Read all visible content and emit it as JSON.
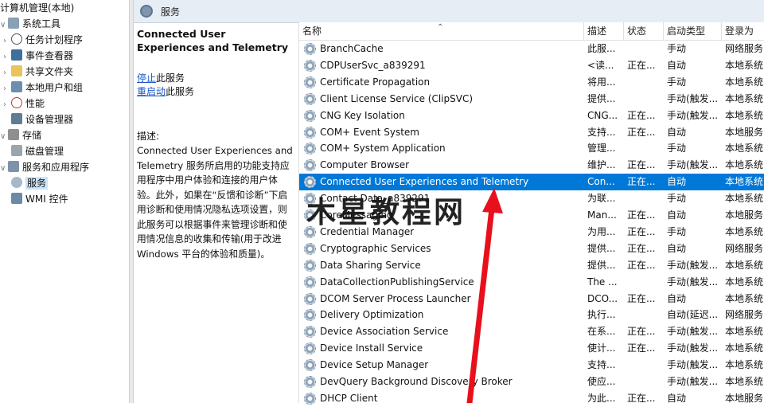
{
  "tree": {
    "root": "计算机管理(本地)",
    "items": [
      {
        "label": "系统工具",
        "icon": "tools-icon"
      },
      {
        "label": "任务计划程序",
        "icon": "clock-icon"
      },
      {
        "label": "事件查看器",
        "icon": "event-viewer-icon"
      },
      {
        "label": "共享文件夹",
        "icon": "shared-folder-icon"
      },
      {
        "label": "本地用户和组",
        "icon": "users-icon"
      },
      {
        "label": "性能",
        "icon": "performance-icon"
      },
      {
        "label": "设备管理器",
        "icon": "device-manager-icon"
      },
      {
        "label": "存储",
        "icon": "storage-icon"
      },
      {
        "label": "磁盘管理",
        "icon": "disk-icon"
      },
      {
        "label": "服务和应用程序",
        "icon": "services-apps-icon"
      },
      {
        "label": "服务",
        "icon": "services-icon"
      },
      {
        "label": "WMI 控件",
        "icon": "wmi-icon"
      }
    ]
  },
  "header": {
    "title": "服务"
  },
  "description": {
    "service_title": "Connected User Experiences and Telemetry",
    "stop_link": "停止",
    "stop_suffix": "此服务",
    "restart_link": "重启动",
    "restart_suffix": "此服务",
    "desc_label": "描述:",
    "desc_text": "Connected User Experiences and Telemetry 服务所启用的功能支持应用程序中用户体验和连接的用户体验。此外，如果在“反馈和诊断”下启用诊断和使用情况隐私选项设置，则此服务可以根据事件来管理诊断和使用情况信息的收集和传输(用于改进 Windows 平台的体验和质量)。"
  },
  "columns": {
    "name": "名称",
    "description": "描述",
    "status": "状态",
    "startup_type": "启动类型",
    "log_on_as": "登录为"
  },
  "services": [
    {
      "name": "BranchCache",
      "desc": "此服...",
      "status": "",
      "startup": "手动",
      "logon": "网络服务"
    },
    {
      "name": "CDPUserSvc_a839291",
      "desc": "<读...",
      "status": "正在...",
      "startup": "自动",
      "logon": "本地系统"
    },
    {
      "name": "Certificate Propagation",
      "desc": "将用...",
      "status": "",
      "startup": "手动",
      "logon": "本地系统"
    },
    {
      "name": "Client License Service (ClipSVC)",
      "desc": "提供...",
      "status": "",
      "startup": "手动(触发...",
      "logon": "本地系统"
    },
    {
      "name": "CNG Key Isolation",
      "desc": "CNG...",
      "status": "正在...",
      "startup": "手动(触发...",
      "logon": "本地系统"
    },
    {
      "name": "COM+ Event System",
      "desc": "支持...",
      "status": "正在...",
      "startup": "自动",
      "logon": "本地服务"
    },
    {
      "name": "COM+ System Application",
      "desc": "管理...",
      "status": "",
      "startup": "手动",
      "logon": "本地系统"
    },
    {
      "name": "Computer Browser",
      "desc": "维护...",
      "status": "正在...",
      "startup": "手动(触发...",
      "logon": "本地系统"
    },
    {
      "name": "Connected User Experiences and Telemetry",
      "desc": "Con...",
      "status": "正在...",
      "startup": "自动",
      "logon": "本地系统",
      "selected": true
    },
    {
      "name": "Contact Data_a839291",
      "desc": "为联...",
      "status": "",
      "startup": "手动",
      "logon": "本地系统"
    },
    {
      "name": "CoreMessaging",
      "desc": "Man...",
      "status": "正在...",
      "startup": "自动",
      "logon": "本地服务"
    },
    {
      "name": "Credential Manager",
      "desc": "为用...",
      "status": "正在...",
      "startup": "手动",
      "logon": "本地系统"
    },
    {
      "name": "Cryptographic Services",
      "desc": "提供...",
      "status": "正在...",
      "startup": "自动",
      "logon": "网络服务"
    },
    {
      "name": "Data Sharing Service",
      "desc": "提供...",
      "status": "正在...",
      "startup": "手动(触发...",
      "logon": "本地系统"
    },
    {
      "name": "DataCollectionPublishingService",
      "desc": "The ...",
      "status": "",
      "startup": "手动(触发...",
      "logon": "本地系统"
    },
    {
      "name": "DCOM Server Process Launcher",
      "desc": "DCO...",
      "status": "正在...",
      "startup": "自动",
      "logon": "本地系统"
    },
    {
      "name": "Delivery Optimization",
      "desc": "执行...",
      "status": "",
      "startup": "自动(延迟...",
      "logon": "网络服务"
    },
    {
      "name": "Device Association Service",
      "desc": "在系...",
      "status": "正在...",
      "startup": "手动(触发...",
      "logon": "本地系统"
    },
    {
      "name": "Device Install Service",
      "desc": "使计...",
      "status": "正在...",
      "startup": "手动(触发...",
      "logon": "本地系统"
    },
    {
      "name": "Device Setup Manager",
      "desc": "支持...",
      "status": "",
      "startup": "手动(触发...",
      "logon": "本地系统"
    },
    {
      "name": "DevQuery Background Discovery Broker",
      "desc": "使应...",
      "status": "",
      "startup": "手动(触发...",
      "logon": "本地系统"
    },
    {
      "name": "DHCP Client",
      "desc": "为此...",
      "status": "正在...",
      "startup": "自动",
      "logon": "本地服务"
    }
  ],
  "watermark": "木星教程网",
  "colors": {
    "selection": "#0078d7",
    "arrow": "#e8101c",
    "link": "#1a56c6",
    "header_bg": "#e7edf5"
  }
}
